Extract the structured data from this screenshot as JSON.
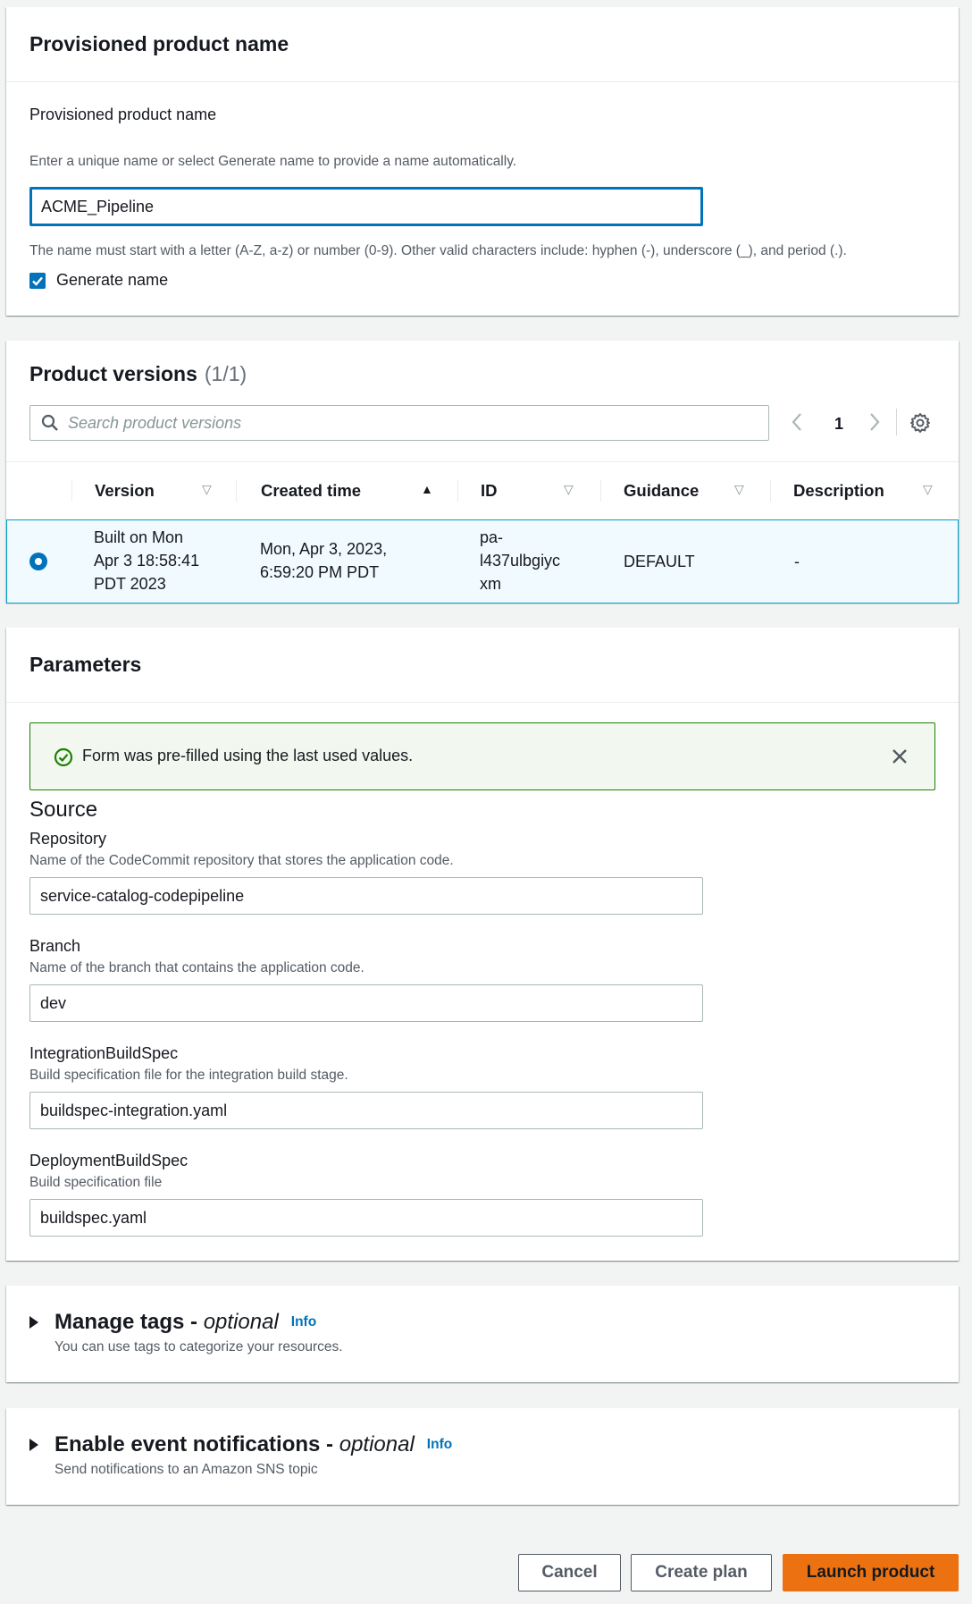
{
  "provisioned": {
    "section_title": "Provisioned product name",
    "field_label": "Provisioned product name",
    "field_description": "Enter a unique name or select Generate name to provide a name automatically.",
    "field_value": "ACME_Pipeline",
    "constraint_text": "The name must start with a letter (A-Z, a-z) or number (0-9). Other valid characters include: hyphen (-), underscore (_), and period (.).",
    "checkbox_label": "Generate name",
    "checkbox_checked": true
  },
  "versions": {
    "title": "Product versions",
    "count": "(1/1)",
    "search_placeholder": "Search product versions",
    "current_page": "1",
    "columns": [
      "Version",
      "Created time",
      "ID",
      "Guidance",
      "Description"
    ],
    "rows": [
      {
        "selected": true,
        "version": [
          "Built on Mon",
          "Apr 3 18:58:41",
          "PDT 2023"
        ],
        "created": [
          "Mon, Apr 3, 2023,",
          "6:59:20 PM PDT"
        ],
        "id": [
          "pa-",
          "l437ulbgiyc",
          "xm"
        ],
        "guidance": "DEFAULT",
        "description": "-"
      }
    ]
  },
  "parameters": {
    "section_title": "Parameters",
    "flash_message": "Form was pre-filled using the last used values.",
    "group_title": "Source",
    "fields": [
      {
        "label": "Repository",
        "description": "Name of the CodeCommit repository that stores the application code.",
        "value": "service-catalog-codepipeline"
      },
      {
        "label": "Branch",
        "description": "Name of the branch that contains the application code.",
        "value": "dev"
      },
      {
        "label": "IntegrationBuildSpec",
        "description": "Build specification file for the integration build stage.",
        "value": "buildspec-integration.yaml"
      },
      {
        "label": "DeploymentBuildSpec",
        "description": "Build specification file",
        "value": "buildspec.yaml"
      }
    ]
  },
  "tags": {
    "title": "Manage tags - ",
    "optional": "optional",
    "info": "Info",
    "description": "You can use tags to categorize your resources."
  },
  "notifications": {
    "title": "Enable event notifications - ",
    "optional": "optional",
    "info": "Info",
    "description": "Send notifications to an Amazon SNS topic"
  },
  "actions": {
    "cancel": "Cancel",
    "create_plan": "Create plan",
    "launch": "Launch product"
  }
}
